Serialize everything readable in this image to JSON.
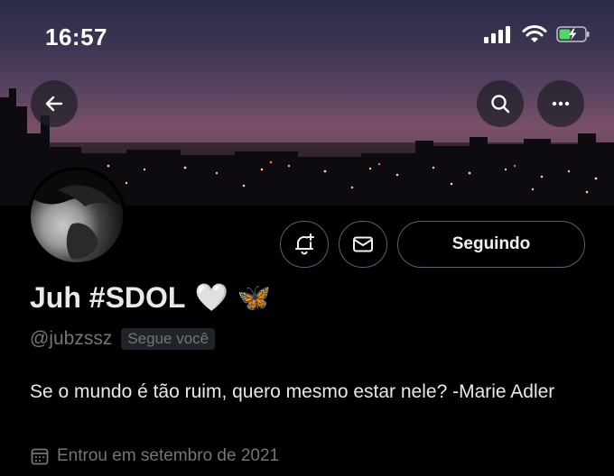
{
  "status_bar": {
    "time": "16:57"
  },
  "header": {
    "back_icon": "arrow-left-icon",
    "search_icon": "search-icon",
    "more_icon": "more-horizontal-icon"
  },
  "profile": {
    "display_name": "Juh #SDOL",
    "name_emojis": [
      "🤍",
      "🦋"
    ],
    "handle": "@jubzssz",
    "follows_you_label": "Segue você",
    "bio": "Se o mundo é tão ruim, quero mesmo estar nele? -Marie Adler",
    "joined_text": "Entrou em setembro de 2021"
  },
  "actions": {
    "notify_icon": "bell-plus-icon",
    "message_icon": "envelope-icon",
    "following_label": "Seguindo"
  },
  "colors": {
    "background": "#000000",
    "text_primary": "#e7e9ea",
    "text_secondary": "#71767b",
    "button_border": "#536471",
    "battery": "#4cd964"
  }
}
